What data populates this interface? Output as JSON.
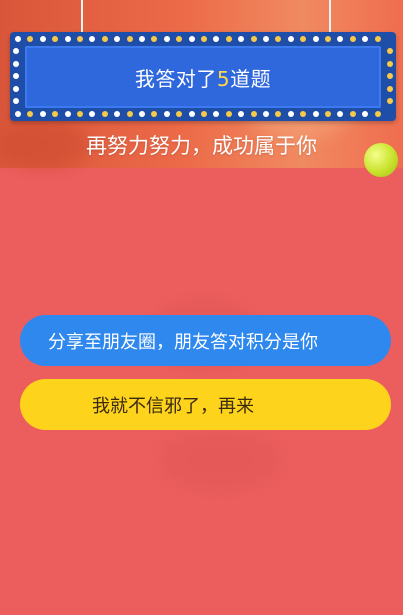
{
  "result": {
    "title_prefix": "我答对了",
    "score": "5",
    "title_suffix": "道题"
  },
  "subtitle": "再努力努力，成功属于你",
  "buttons": {
    "share_label": "分享至朋友圈，朋友答对积分是你",
    "retry_label": "我就不信邪了，再来"
  },
  "colors": {
    "background": "#ec5e5e",
    "marquee_frame": "#1f4ea8",
    "marquee_panel": "#2f67dc",
    "score_highlight": "#ffd54a",
    "share_button": "#2e88ee",
    "retry_button": "#fdd31b"
  }
}
